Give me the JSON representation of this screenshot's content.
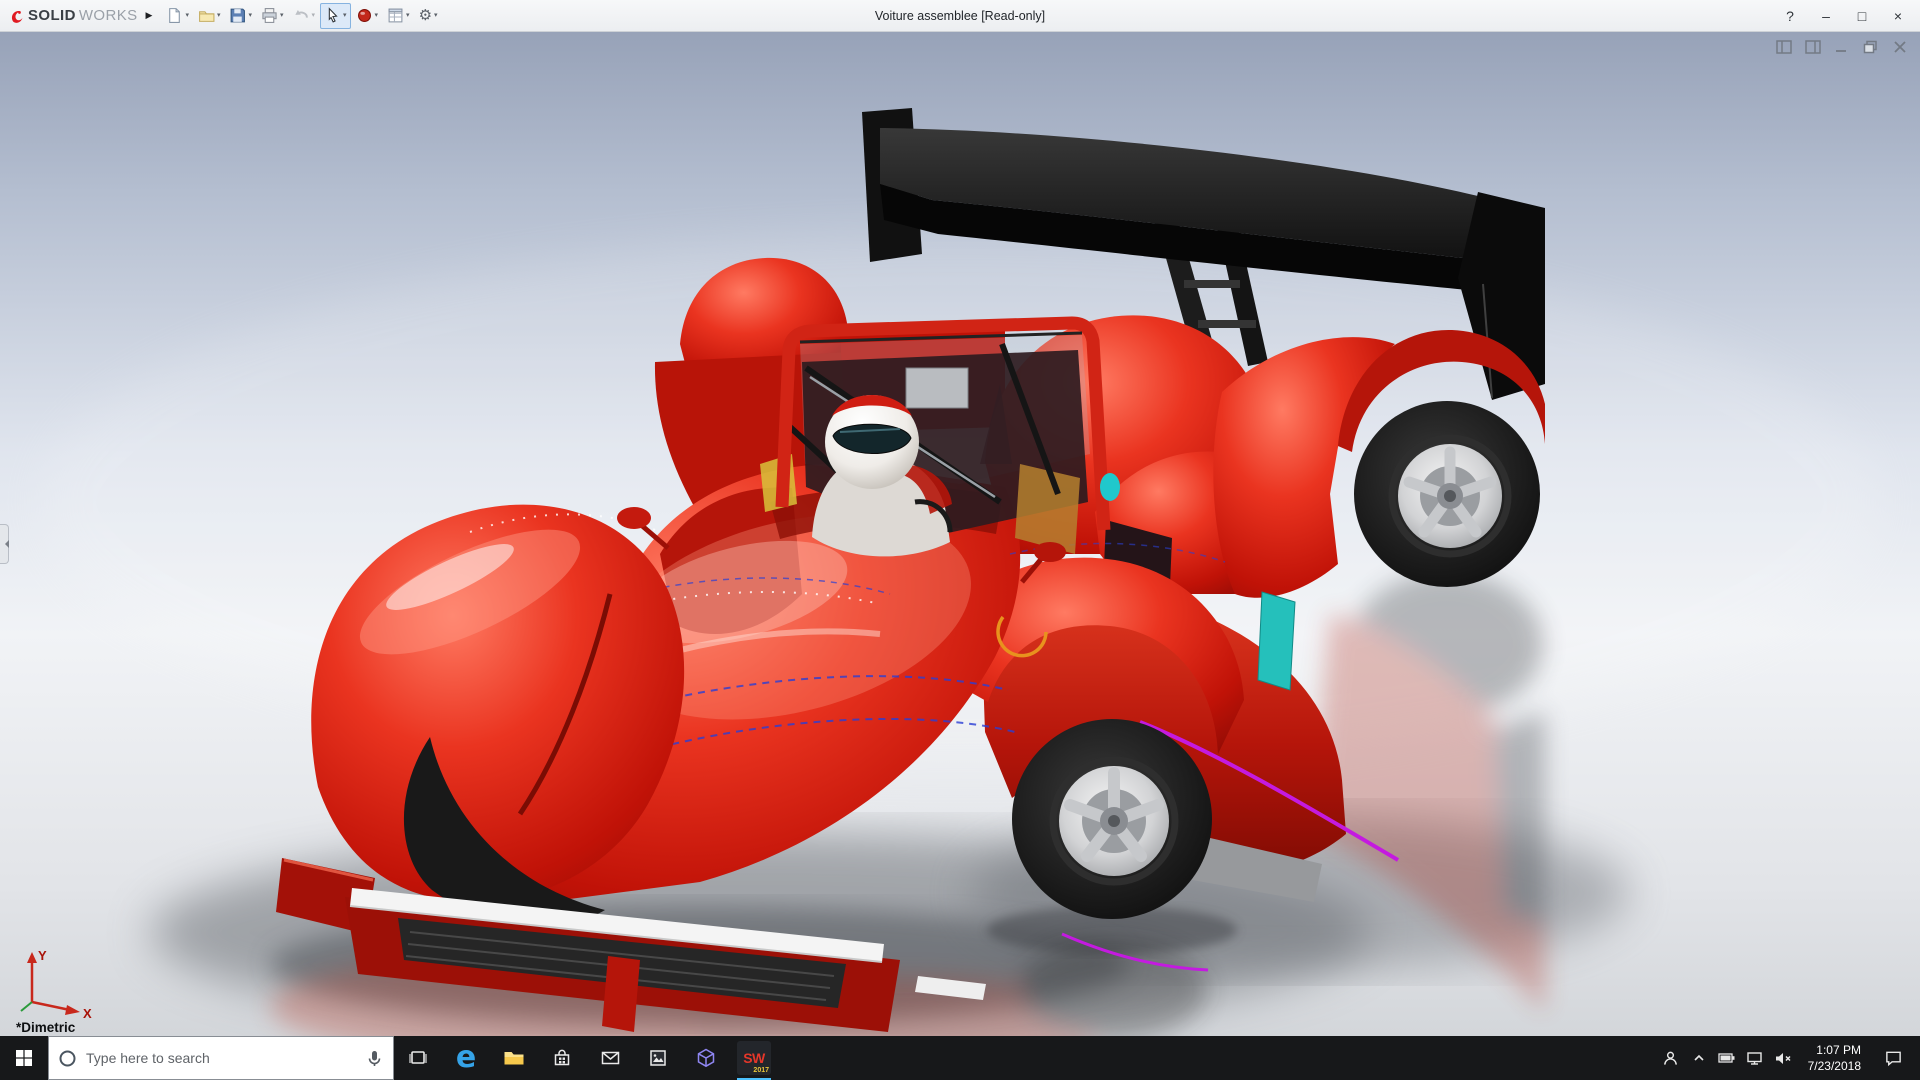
{
  "titlebar": {
    "title": "Voiture assemblee [Read-only]",
    "brand_bold": "SOLID",
    "brand_light": "WORKS",
    "flyout": "▶",
    "dd": "▾",
    "help": "?",
    "min": "–",
    "max": "□",
    "close": "×",
    "gear": "⚙"
  },
  "toolbar_icons": [
    "new-document",
    "open",
    "save",
    "print",
    "undo",
    "select",
    "appearance",
    "design-table",
    "options"
  ],
  "viewport": {
    "view_orientation": "*Dimetric",
    "axis_x": "X",
    "axis_y": "Y",
    "doc_controls": [
      "pane-left",
      "pane-right",
      "minimize",
      "restore",
      "close"
    ]
  },
  "taskbar": {
    "search_placeholder": "Type here to search",
    "edge_glyph": "e",
    "sw_label": "SW",
    "sw_year": "2017",
    "clock_time": "1:07 PM",
    "clock_date": "7/23/2018",
    "apps": [
      "start",
      "cortana-search",
      "task-view",
      "edge",
      "file-explorer",
      "store",
      "mail",
      "photos",
      "3d-builder",
      "solidworks"
    ],
    "tray": [
      "people",
      "hidden-icons",
      "battery",
      "network",
      "volume-muted",
      "action-center",
      "show-desktop"
    ]
  },
  "colors": {
    "car_red": "#c01207",
    "accent_blue": "#4cc2ff",
    "taskbar_bg": "#17181a",
    "titlebar_bg": "#f0f1f3"
  }
}
